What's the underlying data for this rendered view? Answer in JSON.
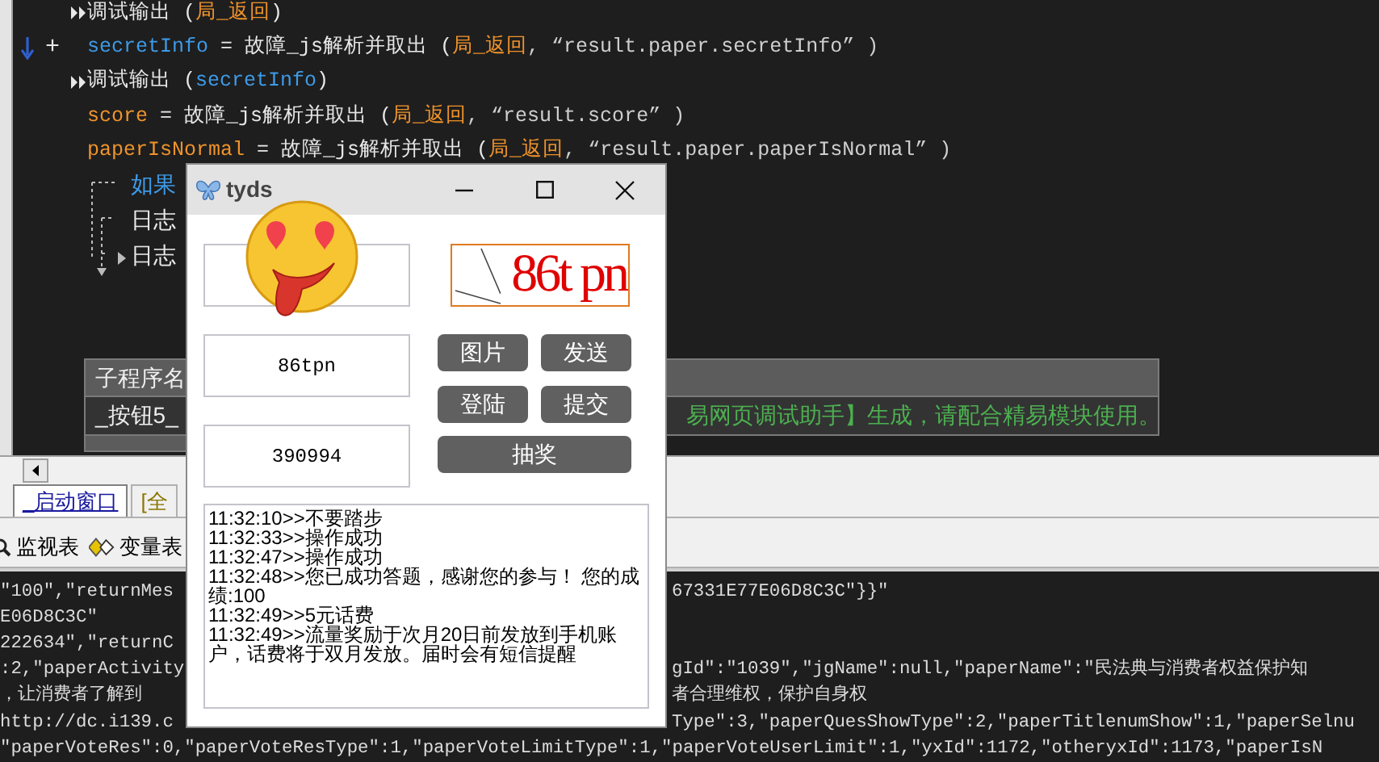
{
  "code_lines": [
    {
      "call": true,
      "arrow": false,
      "tokens": [
        {
          "text": "调试输出 (",
          "kind": "plain"
        },
        {
          "text": "局_返回",
          "kind": "local"
        },
        {
          "text": ")",
          "kind": "plain"
        }
      ]
    },
    {
      "call": false,
      "prefix": "+",
      "arrow": true,
      "tokens": [
        {
          "text": "secretInfo",
          "kind": "global"
        },
        {
          "text": " = 故障_js解析并取出 (",
          "kind": "plain"
        },
        {
          "text": "局_返回",
          "kind": "local"
        },
        {
          "text": ", “result.paper.secretInfo” )",
          "kind": "string"
        }
      ]
    },
    {
      "call": true,
      "arrow": false,
      "tokens": [
        {
          "text": "调试输出 (",
          "kind": "plain"
        },
        {
          "text": "secretInfo",
          "kind": "global"
        },
        {
          "text": ")",
          "kind": "plain"
        }
      ]
    },
    {
      "call": false,
      "arrow": false,
      "tokens": [
        {
          "text": "score",
          "kind": "local"
        },
        {
          "text": " = 故障_js解析并取出 (",
          "kind": "plain"
        },
        {
          "text": "局_返回",
          "kind": "local"
        },
        {
          "text": ", “result.score” )",
          "kind": "string"
        }
      ]
    },
    {
      "call": false,
      "arrow": false,
      "tokens": [
        {
          "text": "paperIsNormal",
          "kind": "local"
        },
        {
          "text": " = 故障_js解析并取出 (",
          "kind": "plain"
        },
        {
          "text": "局_返回",
          "kind": "local"
        },
        {
          "text": ", “result.paper.paperIsNormal” )",
          "kind": "string"
        }
      ]
    }
  ],
  "tree_lines": [
    {
      "label": "如果",
      "kind": "keyword",
      "expandable": false
    },
    {
      "label": "日志",
      "kind": "plain",
      "expandable": false
    },
    {
      "label": "日志",
      "kind": "plain",
      "expandable": true
    }
  ],
  "table": {
    "header": "子程序名",
    "row_left": "_按钮5_",
    "row_right": "易网页调试助手】生成，请配合精易模块使用。"
  },
  "tabs": [
    {
      "label": "_启动窗口",
      "selected": true
    },
    {
      "label": "[全",
      "selected": false
    }
  ],
  "toolbar": [
    {
      "label": "监视表",
      "kind": "watch"
    },
    {
      "label": "变量表",
      "kind": "variables"
    }
  ],
  "console_lines": [
    {
      "left": "\"100\",\"returnMes",
      "right": "67331E77E06D8C3C\"}}\""
    },
    {
      "left": "E06D8C3C\""
    },
    {
      "left": "222634\",\"returnC"
    },
    {
      "left": ":2,\"paperActivity",
      "right": "gId\":\"1039\",\"jgName\":null,\"paperName\":\"民法典与消费者权益保护知"
    },
    {
      "left": "，让消费者了解到",
      "right": "者合理维权，保护自身权"
    },
    {
      "left": "http://dc.i139.c",
      "right": "Type\":3,\"paperQuesShowType\":2,\"paperTitlenumShow\":1,\"paperSelnu"
    },
    {
      "left": "\"paperVoteRes\":0,\"paperVoteResType\":1,\"paperVoteLimitType\":1,\"paperVoteUserLimit\":1,\"yxId\":1172,\"otheryxId\":1173,\"paperIsN"
    }
  ],
  "dialog": {
    "title": "tyds",
    "captcha_text": "86t pn",
    "fields": [
      {
        "value": "86tpn"
      },
      {
        "value": "390994"
      }
    ],
    "buttons": [
      "图片",
      "发送",
      "登陆",
      "提交"
    ],
    "draw_button": "抽奖",
    "log": [
      "11:32:10>>不要踏步",
      "11:32:33>>操作成功",
      "11:32:47>>操作成功",
      "11:32:48>>您已成功答题，感谢您的参与！ 您的成绩:100",
      "11:32:49>>5元话费",
      "11:32:49>>流量奖励于次月20日前发放到手机账户，话费将于双月发放。届时会有短信提醒"
    ]
  }
}
